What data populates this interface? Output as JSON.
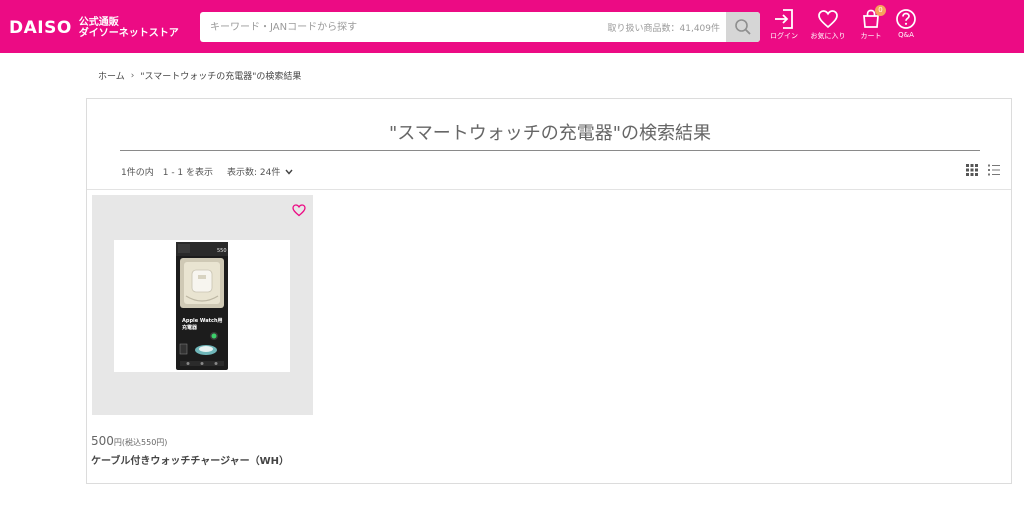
{
  "brand": {
    "logo_text": "DAISO",
    "sub_line1": "公式通販",
    "sub_line2": "ダイソーネットストア"
  },
  "search": {
    "placeholder": "キーワード・JANコードから探す",
    "item_count": "取り扱い商品数：41,409件",
    "icon": "search-icon"
  },
  "header_nav": {
    "login": {
      "label": "ログイン",
      "icon": "login-icon"
    },
    "favorites": {
      "label": "お気に入り",
      "icon": "heart-icon"
    },
    "cart": {
      "label": "カート",
      "icon": "cart-icon",
      "badge": "0"
    },
    "qa": {
      "label": "Q&A",
      "icon": "help-icon"
    }
  },
  "breadcrumb": {
    "home": "ホーム",
    "current": "\"スマートウォッチの充電器\"の検索結果"
  },
  "results": {
    "title": "\"スマートウォッチの充電器\"の検索結果",
    "count_text": "1件の内　1 - 1 を表示",
    "per_page_label": "表示数: 24件",
    "view_grid_icon": "grid-view-icon",
    "view_list_icon": "list-view-icon"
  },
  "products": [
    {
      "price_main": "500",
      "price_unit": "円(税込550円)",
      "name": "ケーブル付きウォッチチャージャー（WH）",
      "package_text_1": "Apple Watch用",
      "package_text_2": "充電器",
      "package_price_tag": "550"
    }
  ],
  "colors": {
    "brand_pink": "#ec0b84",
    "badge_orange": "#f7a35c"
  }
}
